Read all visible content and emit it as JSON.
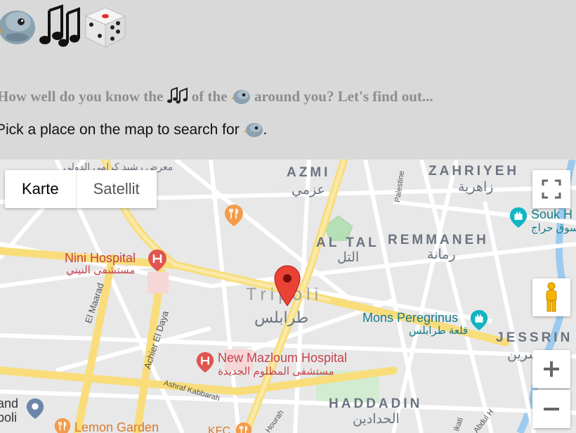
{
  "header": {
    "tagline_start": "How well do you know the",
    "tagline_mid": "of the",
    "tagline_end": "around you? Let's find out...",
    "instruction": "Pick a place on the map to search for",
    "instruction_end": "."
  },
  "icons": [
    "bird-icon",
    "music-notes-icon",
    "dice-icon",
    "fullscreen-icon",
    "pegman-icon",
    "zoom-in-icon",
    "zoom-out-icon",
    "restaurant-icon",
    "hospital-icon",
    "landmark-icon",
    "map-pin-icon"
  ],
  "map": {
    "map_type": {
      "map_label": "Karte",
      "satellite_label": "Satellit",
      "selected": "Karte"
    },
    "districts": [
      {
        "name": "AZMI",
        "arabic": "عزمي"
      },
      {
        "name": "ZAHRIYEH",
        "arabic": "زاهرية"
      },
      {
        "name": "AL TAL",
        "arabic": "التل"
      },
      {
        "name": "REMMANEH",
        "arabic": "رمانة"
      },
      {
        "name": "JESSRIN",
        "arabic": "جسرين"
      },
      {
        "name": "HADDADIN",
        "arabic": "الحدادين"
      }
    ],
    "city": {
      "name": "Tripoli",
      "arabic": "طرابلس"
    },
    "pois": {
      "nini_hospital": "Nini Hospital",
      "nini_hospital_ar": "مستشفى النيني",
      "new_mazloum": "New Mazloum Hospital",
      "new_mazloum_ar": "مستشفى المظلوم الجديدة",
      "mons_peregrinus": "Mons Peregrinus",
      "mons_peregrinus_ar": "قلعة طرابلس",
      "souk": "Souk H",
      "souk_ar": "سوق حراج",
      "lemon_garden": "Lemon Garden",
      "top_left_ar": "معرض رشيد كرامي الدولي",
      "land_partial": "and",
      "poli_partial": "poli",
      "kfc_partial": "KFC"
    },
    "streets": [
      "El Maarad",
      "Achier El Daya",
      "Ashraf Kabbarah",
      "Palestine",
      "Hourah",
      "ikati",
      "Abdul H"
    ]
  }
}
